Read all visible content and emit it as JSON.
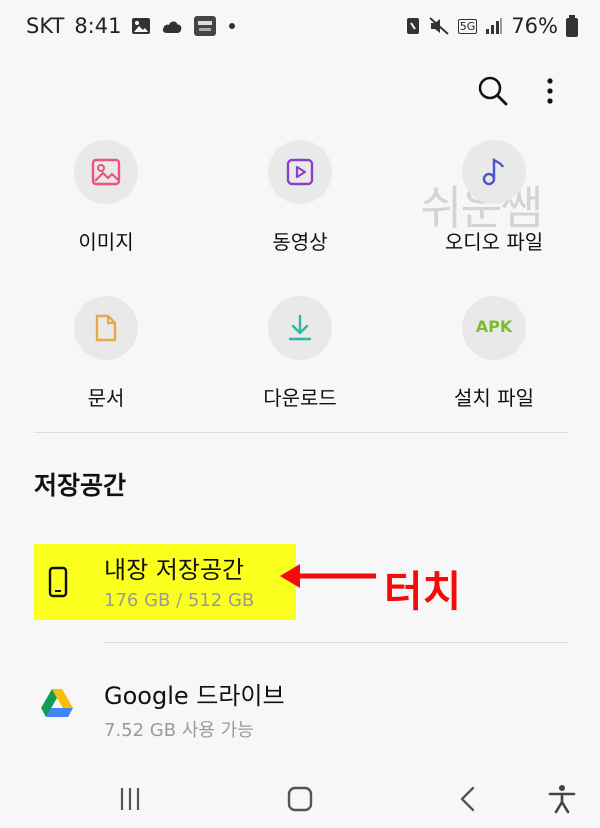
{
  "status": {
    "carrier": "SKT",
    "time": "8:41",
    "network": "5G",
    "battery": "76%"
  },
  "toolbar": {
    "search_icon": "search-icon",
    "more_icon": "more-vert-icon"
  },
  "categories": [
    {
      "label": "이미지",
      "icon": "image-icon",
      "color": "#e8547a"
    },
    {
      "label": "동영상",
      "icon": "video-icon",
      "color": "#8a3fd0"
    },
    {
      "label": "오디오 파일",
      "icon": "audio-icon",
      "color": "#4a57c9"
    },
    {
      "label": "문서",
      "icon": "document-icon",
      "color": "#e8a64a"
    },
    {
      "label": "다운로드",
      "icon": "download-icon",
      "color": "#2fb7a3"
    },
    {
      "label": "설치 파일",
      "icon": "apk-icon",
      "color": "#7dbd2d",
      "badge": "APK"
    }
  ],
  "watermark": "쉬운쌤",
  "storage": {
    "title": "저장공간",
    "items": [
      {
        "name": "내장 저장공간",
        "detail": "176 GB / 512 GB",
        "icon": "phone-icon"
      },
      {
        "name": "Google 드라이브",
        "detail": "7.52 GB 사용 가능",
        "icon": "google-drive-icon"
      }
    ]
  },
  "annotation": {
    "text": "터치",
    "color": "#f20c0c",
    "highlight_color": "#fbff1e"
  },
  "navbar": {
    "recents_icon": "recents-icon",
    "home_icon": "home-icon",
    "back_icon": "back-icon",
    "accessibility_icon": "accessibility-icon"
  }
}
